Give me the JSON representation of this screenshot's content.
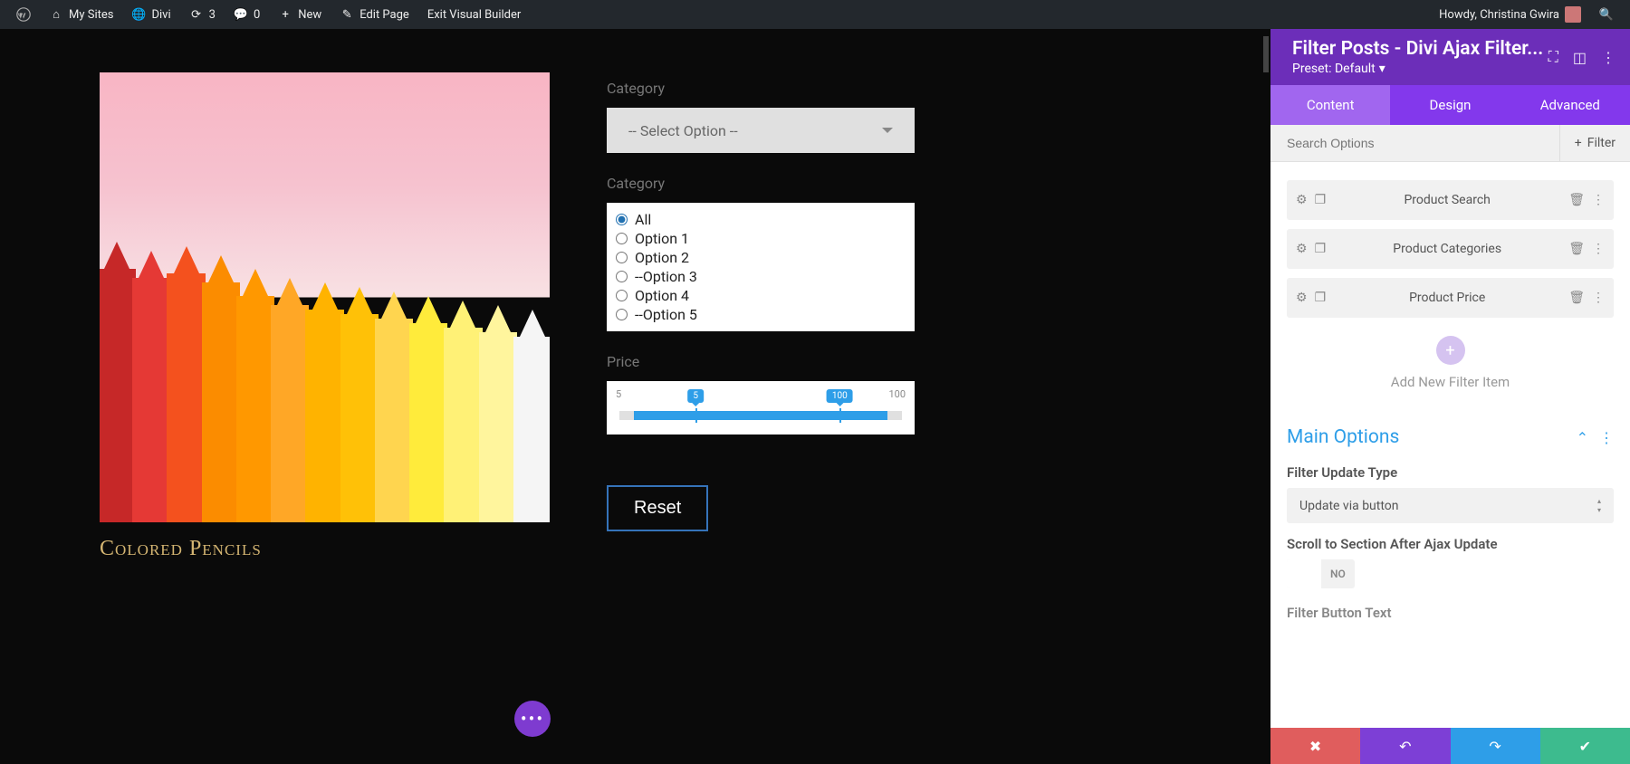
{
  "adminbar": {
    "my_sites": "My Sites",
    "divi": "Divi",
    "updates_count": "3",
    "comments_count": "0",
    "new": "New",
    "edit_page": "Edit Page",
    "exit_vb": "Exit Visual Builder",
    "howdy": "Howdy, Christina Gwira"
  },
  "preview": {
    "category1_label": "Category",
    "select_placeholder": "-- Select Option --",
    "category2_label": "Category",
    "radios": {
      "all": "All",
      "opt1": "Option 1",
      "opt2": "Option 2",
      "opt3": "--Option 3",
      "opt4": "Option 4",
      "opt5": "--Option 5"
    },
    "price_label": "Price",
    "slider": {
      "min": "5",
      "max": "100",
      "low": "5",
      "high": "100"
    },
    "reset": "Reset",
    "product_title": "Colored Pencils",
    "fab": "•••"
  },
  "panel": {
    "title": "Filter Posts - Divi Ajax Filter...",
    "preset": "Preset: Default",
    "tabs": {
      "content": "Content",
      "design": "Design",
      "advanced": "Advanced"
    },
    "search_placeholder": "Search Options",
    "filter_btn": "Filter",
    "filters": {
      "search": "Product Search",
      "categories": "Product Categories",
      "price": "Product Price"
    },
    "add_filter": "Add New Filter Item",
    "main_options": "Main Options",
    "filter_update_label": "Filter Update Type",
    "filter_update_value": "Update via button",
    "scroll_label": "Scroll to Section After Ajax Update",
    "scroll_value": "NO",
    "button_text_label": "Filter Button Text"
  }
}
